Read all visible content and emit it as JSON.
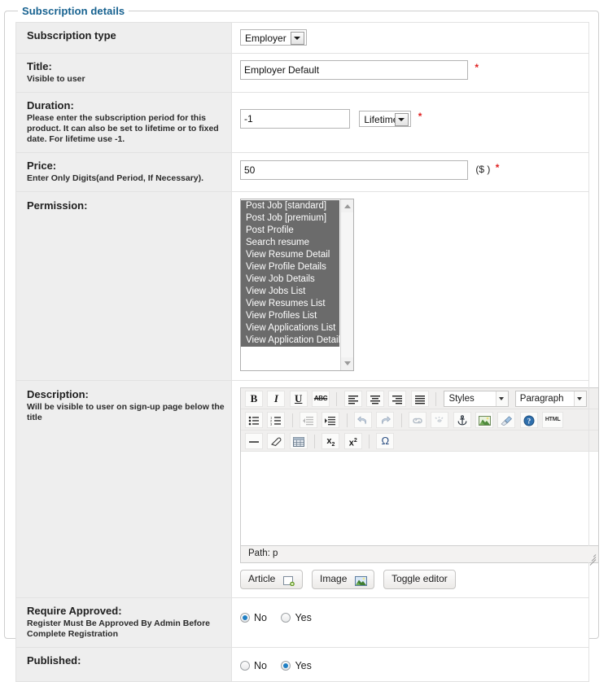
{
  "legend": "Subscription details",
  "colors": {
    "legend": "#16618f",
    "required": "#e02020",
    "label_bg": "#eeeeee",
    "selected_option_bg": "#6b6b6b",
    "radio_accent": "#1f7fc4"
  },
  "rows": {
    "subscription_type": {
      "label": "Subscription type",
      "select_value": "Employer"
    },
    "title": {
      "label": "Title:",
      "hint": "Visible to user",
      "value": "Employer Default",
      "required_mark": "*"
    },
    "duration": {
      "label": "Duration:",
      "hint": "Please enter the subscription period for this product. It can also be set to lifetime or to fixed date. For lifetime use -1.",
      "value": "-1",
      "select_value": "Lifetime",
      "required_mark": "*"
    },
    "price": {
      "label": "Price:",
      "hint": "Enter Only Digits(and Period, If Necessary).",
      "value": "50",
      "unit": "($ )",
      "required_mark": "*"
    },
    "permission": {
      "label": "Permission:",
      "options": [
        {
          "label": "Post Job [standard]",
          "selected": true
        },
        {
          "label": "Post Job [premium]",
          "selected": true
        },
        {
          "label": "Post Profile",
          "selected": true
        },
        {
          "label": "Search resume",
          "selected": true
        },
        {
          "label": "View Resume Detail",
          "selected": true
        },
        {
          "label": "View Profile Details",
          "selected": true
        },
        {
          "label": "View Job Details",
          "selected": true
        },
        {
          "label": "View Jobs List",
          "selected": true
        },
        {
          "label": "View Resumes List",
          "selected": true
        },
        {
          "label": "View Profiles List",
          "selected": true
        },
        {
          "label": "View Applications List",
          "selected": true
        },
        {
          "label": "View Application Details",
          "selected": true
        }
      ]
    },
    "description": {
      "label": "Description:",
      "hint": "Will be visible to user on sign-up page below the title",
      "editor": {
        "toolbar_row1": [
          {
            "name": "bold-icon",
            "glyph": "B"
          },
          {
            "name": "italic-icon",
            "glyph": "I"
          },
          {
            "name": "underline-icon",
            "glyph": "U"
          },
          {
            "name": "strikethrough-icon",
            "glyph": "ABC"
          },
          {
            "name": "separator",
            "glyph": "|"
          },
          {
            "name": "align-left-icon",
            "glyph": ""
          },
          {
            "name": "align-center-icon",
            "glyph": ""
          },
          {
            "name": "align-right-icon",
            "glyph": ""
          },
          {
            "name": "align-justify-icon",
            "glyph": ""
          },
          {
            "name": "separator",
            "glyph": "|"
          }
        ],
        "styles_select": "Styles",
        "format_select": "Paragraph",
        "toolbar_row2": [
          {
            "name": "bullet-list-icon"
          },
          {
            "name": "numbered-list-icon"
          },
          {
            "name": "separator"
          },
          {
            "name": "outdent-icon"
          },
          {
            "name": "indent-icon"
          },
          {
            "name": "separator"
          },
          {
            "name": "undo-icon"
          },
          {
            "name": "redo-icon"
          },
          {
            "name": "separator"
          },
          {
            "name": "link-icon"
          },
          {
            "name": "unlink-icon"
          },
          {
            "name": "anchor-icon"
          },
          {
            "name": "image-icon"
          },
          {
            "name": "cleanup-icon"
          },
          {
            "name": "help-icon"
          },
          {
            "name": "html-source-icon",
            "glyph": "HTML"
          }
        ],
        "toolbar_row3": [
          {
            "name": "horizontal-rule-icon"
          },
          {
            "name": "remove-format-icon"
          },
          {
            "name": "table-icon"
          },
          {
            "name": "separator"
          },
          {
            "name": "subscript-icon",
            "glyph": "x₂"
          },
          {
            "name": "superscript-icon",
            "glyph": "x²"
          },
          {
            "name": "separator"
          },
          {
            "name": "special-char-icon",
            "glyph": "Ω"
          }
        ],
        "content": "",
        "status_path": "Path: p"
      },
      "buttons": [
        {
          "label": "Article",
          "icon": "article-icon"
        },
        {
          "label": "Image",
          "icon": "image-icon"
        },
        {
          "label": "Toggle editor",
          "icon": ""
        }
      ]
    },
    "require_approved": {
      "label": "Require Approved:",
      "hint": "Register Must Be Approved By Admin Before Complete Registration",
      "options": [
        "No",
        "Yes"
      ],
      "selected": "No"
    },
    "published": {
      "label": "Published:",
      "options": [
        "No",
        "Yes"
      ],
      "selected": "Yes"
    }
  }
}
